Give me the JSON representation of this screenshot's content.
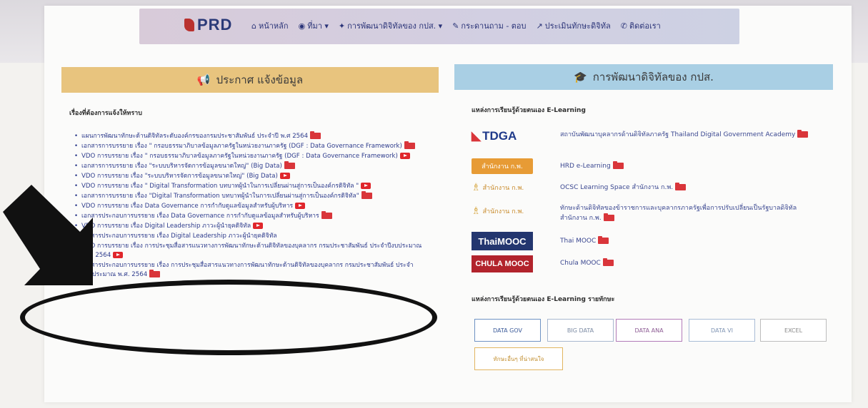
{
  "nav": {
    "logo_text": "PRD",
    "items": [
      {
        "icon": "home-icon",
        "glyph": "⌂",
        "label": "หน้าหลัก"
      },
      {
        "icon": "info-icon",
        "glyph": "◉",
        "label": "ที่มา ▾"
      },
      {
        "icon": "mortarboard-icon",
        "glyph": "✦",
        "label": "การพัฒนาดิจิทัลของ กปส. ▾"
      },
      {
        "icon": "chat-icon",
        "glyph": "✎",
        "label": "กระดานถาม - ตอบ"
      },
      {
        "icon": "chart-icon",
        "glyph": "↗",
        "label": "ประเมินทักษะดิจิทัล"
      },
      {
        "icon": "phone-icon",
        "glyph": "✆",
        "label": "ติดต่อเรา"
      }
    ]
  },
  "left": {
    "header": "ประกาศ แจ้งข้อมูล",
    "section_title": "เรื่องที่ต้องการแจ้งให้ทราบ",
    "items": [
      {
        "text": "แผนการพัฒนาทักษะด้านดิจิทัลระดับองค์กรของกรมประชาสัมพันธ์ ประจำปี พ.ศ 2564",
        "icon": "folder"
      },
      {
        "text": "เอกสารการบรรยาย เรื่อง \" กรอบธรรมาภิบาลข้อมูลภาครัฐในหน่วยงานภาครัฐ (DGF : Data Governance Framework)",
        "icon": "folder"
      },
      {
        "text": "VDO การบรรยาย เรื่อง \" กรอบธรรมาภิบาลข้อมูลภาครัฐในหน่วยงานภาครัฐ (DGF : Data Governance Framework)",
        "icon": "youtube"
      },
      {
        "text": "เอกสารการบรรยาย เรื่อง \"ระบบบริหารจัดการข้อมูลขนาดใหญ่\" (Big Data)",
        "icon": "folder"
      },
      {
        "text": "VDO การบรรยาย เรื่อง \"ระบบบริหารจัดการข้อมูลขนาดใหญ่\" (Big Data)",
        "icon": "youtube"
      },
      {
        "text": "VDO การบรรยาย เรื่อง \" Digital Transformation บทบาทผู้นำในการเปลี่ยนผ่านสู่การเป็นองค์กรดิจิทัล \"",
        "icon": "youtube"
      },
      {
        "text": "เอกสารการบรรยาย เรื่อง \"Digital Transformation บทบาทผู้นำในการเปลี่ยนผ่านสู่การเป็นองค์กรดิจิทัล\"",
        "icon": "folder"
      },
      {
        "text": "VDO การบรรยาย เรื่อง Data Governance การกำกับดูแลข้อมูลสำหรับผู้บริหาร",
        "icon": "youtube"
      },
      {
        "text": "เอกสารประกอบการบรรยาย เรื่อง Data Governance การกำกับดูแลข้อมูลสำหรับผู้บริหาร",
        "icon": "folder"
      },
      {
        "text": "VDO การบรรยาย เรื่อง Digital Leadership ภาวะผู้นำยุคดิจิทัล",
        "icon": "youtube"
      },
      {
        "text": "เอกสารประกอบการบรรยาย เรื่อง Digital Leadership ภาวะผู้นำยุคดิจิทัล",
        "icon": "none"
      },
      {
        "text": "VDO การบรรยาย เรื่อง การประชุมสื่อสารแนวทางการพัฒนาทักษะด้านดิจิทัลของบุคลากร กรมประชาสัมพันธ์ ประจำปีงบประมาณ พ.ศ. 2564",
        "icon": "youtube"
      },
      {
        "text": "เอกสารประกอบการบรรยาย เรื่อง การประชุมสื่อสารแนวทางการพัฒนาทักษะด้านดิจิทัลของบุคลากร กรมประชาสัมพันธ์ ประจำปีงบประมาณ พ.ศ. 2564",
        "icon": "folder"
      }
    ]
  },
  "right": {
    "header": "การพัฒนาดิจิทัลของ กปส.",
    "section_title": "แหล่งการเรียนรู้ด้วยตนเอง E-Learning",
    "sources": [
      {
        "logo": "TDGA",
        "text": "สถาบันพัฒนาบุคลากรด้านดิจิทัลภาครัฐ Thailand Digital Government Academy"
      },
      {
        "logo": "สำนักงาน ก.พ.",
        "text": "HRD e-Learning"
      },
      {
        "logo": "สำนักงาน ก.พ.",
        "text": "OCSC Learning Space สำนักงาน ก.พ."
      },
      {
        "logo": "สำนักงาน ก.พ.",
        "text": "ทักษะด้านดิจิทัลของข้าราชการและบุคลากรภาครัฐเพื่อการปรับเปลี่ยนเป็นรัฐบาลดิจิทัล สำนักงาน ก.พ."
      },
      {
        "logo": "ThaiMOOC",
        "text": "Thai MOOC"
      },
      {
        "logo": "CHULA MOOC",
        "text": "Chula MOOC"
      }
    ],
    "skills_title": "แหล่งการเรียนรู้ด้วยตนเอง E-Learning รายทักษะ",
    "tags": [
      "DATA GOV",
      "BIG DATA",
      "DATA ANA",
      "DATA VI",
      "EXCEL",
      "ทักษะอื่นๆ ที่น่าสนใจ"
    ]
  },
  "colors": {
    "left_header": "#e8c47e",
    "right_header": "#a9cfe4",
    "link": "#2d3b8c",
    "accent_red": "#d9353a"
  }
}
